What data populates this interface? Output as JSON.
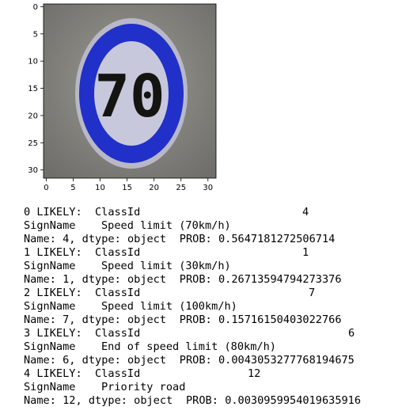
{
  "figure": {
    "x_ticks": [
      "0",
      "5",
      "10",
      "15",
      "20",
      "25",
      "30"
    ],
    "y_ticks": [
      "0",
      "5",
      "10",
      "15",
      "20",
      "25",
      "30"
    ],
    "image_digits": "70",
    "x_range": [
      -0.5,
      31.5
    ],
    "y_range": [
      -0.5,
      31.5
    ]
  },
  "output": {
    "results": [
      {
        "rank_label": "0 LIKELY:",
        "classid_label": "ClassId",
        "classid_value": "4",
        "signname_label": "SignName",
        "signname_value": "Speed limit (70km/h)",
        "name_line": "Name: 4, dtype: object",
        "prob_label": "PROB:",
        "prob_value": "0.5647181272506714"
      },
      {
        "rank_label": "1 LIKELY:",
        "classid_label": "ClassId",
        "classid_value": "1",
        "signname_label": "SignName",
        "signname_value": "Speed limit (30km/h)",
        "name_line": "Name: 1, dtype: object",
        "prob_label": "PROB:",
        "prob_value": "0.26713594794273376"
      },
      {
        "rank_label": "2 LIKELY:",
        "classid_label": "ClassId",
        "classid_value": "7",
        "signname_label": "SignName",
        "signname_value": "Speed limit (100km/h)",
        "name_line": "Name: 7, dtype: object",
        "prob_label": "PROB:",
        "prob_value": "0.15716150403022766"
      },
      {
        "rank_label": "3 LIKELY:",
        "classid_label": "ClassId",
        "classid_value": "6",
        "signname_label": "SignName",
        "signname_value": "End of speed limit (80km/h)",
        "name_line": "Name: 6, dtype: object",
        "prob_label": "PROB:",
        "prob_value": "0.0043053277768194675"
      },
      {
        "rank_label": "4 LIKELY:",
        "classid_label": "ClassId",
        "classid_value": "12",
        "signname_label": "SignName",
        "signname_value": "Priority road",
        "name_line": "Name: 12, dtype: object",
        "prob_label": "PROB:",
        "prob_value": "0.0030959954019635916"
      }
    ]
  },
  "colors": {
    "sign_blue": "#2030c8",
    "sign_white": "#c8c8dc",
    "background_gray": "#8a8a86",
    "digit_black": "#141410"
  }
}
